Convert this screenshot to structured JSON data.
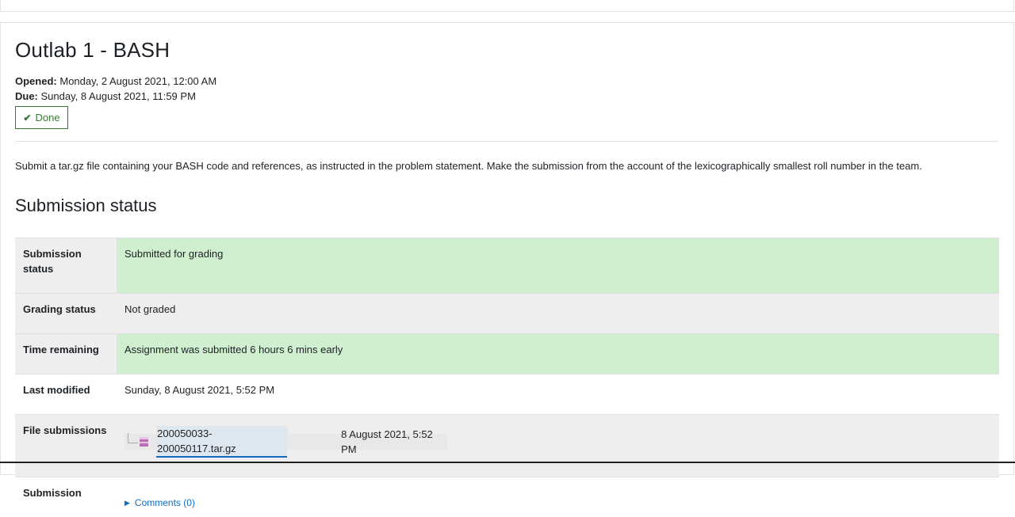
{
  "assignment": {
    "title": "Outlab 1 - BASH",
    "opened_label": "Opened:",
    "opened_value": "Monday, 2 August 2021, 12:00 AM",
    "due_label": "Due:",
    "due_value": "Sunday, 8 August 2021, 11:59 PM",
    "done_label": "Done",
    "description": "Submit a tar.gz file containing your BASH code and references, as instructed in the problem statement. Make the submission from the account of the lexicographically smallest roll number in the team."
  },
  "submission": {
    "heading": "Submission status",
    "rows": [
      {
        "label": "Submission status",
        "value": "Submitted for grading"
      },
      {
        "label": "Grading status",
        "value": "Not graded"
      },
      {
        "label": "Time remaining",
        "value": "Assignment was submitted 6 hours 6 mins early"
      },
      {
        "label": "Last modified",
        "value": "Sunday, 8 August 2021, 5:52 PM"
      },
      {
        "label": "File submissions",
        "file_name": "200050033-200050117.tar.gz",
        "file_date": "8 August 2021, 5:52 PM"
      },
      {
        "label": "Submission",
        "comments_label": "Comments (0)"
      }
    ]
  },
  "colors": {
    "green_row": "#cfefcf",
    "grey_row": "#eeeeee",
    "done_green": "#357a32",
    "link_blue": "#0f6cbf"
  },
  "icons": [
    "check-icon",
    "file-archive-icon",
    "tree-branch-icon",
    "caret-right-icon"
  ]
}
